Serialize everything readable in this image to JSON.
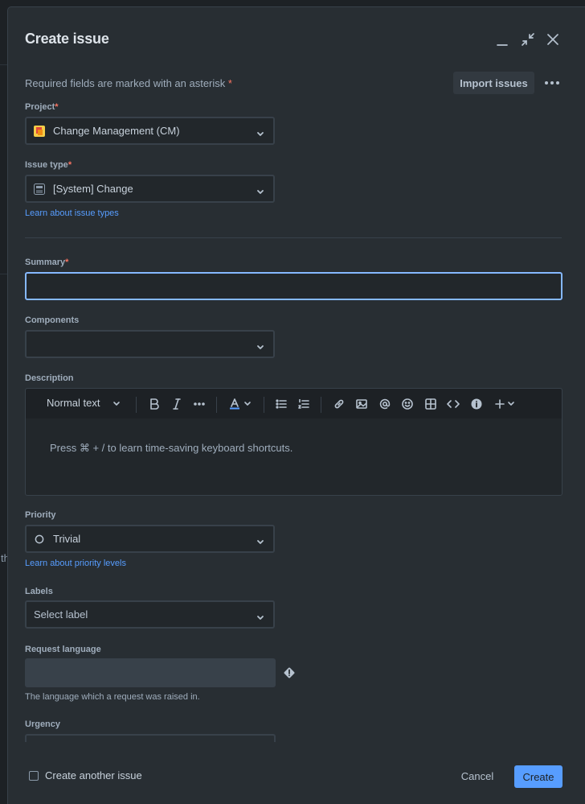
{
  "modal": {
    "title": "Create issue",
    "required_note": "Required fields are marked with an asterisk",
    "asterisk": "*",
    "import_button": "Import issues"
  },
  "fields": {
    "project": {
      "label": "Project",
      "value": "Change Management (CM)"
    },
    "issue_type": {
      "label": "Issue type",
      "value": "[System] Change",
      "help_link": "Learn about issue types"
    },
    "summary": {
      "label": "Summary",
      "value": ""
    },
    "components": {
      "label": "Components",
      "value": ""
    },
    "description": {
      "label": "Description",
      "text_style": "Normal text",
      "hint": "Press ⌘ + / to learn time-saving keyboard shortcuts."
    },
    "priority": {
      "label": "Priority",
      "value": "Trivial",
      "help_link": "Learn about priority levels"
    },
    "labels": {
      "label": "Labels",
      "placeholder": "Select label"
    },
    "request_language": {
      "label": "Request language",
      "help_text": "The language which a request was raised in."
    },
    "urgency": {
      "label": "Urgency"
    }
  },
  "footer": {
    "create_another": "Create another issue",
    "cancel": "Cancel",
    "create": "Create"
  },
  "background": {
    "stray_text": "th"
  },
  "colors": {
    "accent": "#579dff",
    "required": "#f87462",
    "focus_border": "#85b8ff"
  }
}
